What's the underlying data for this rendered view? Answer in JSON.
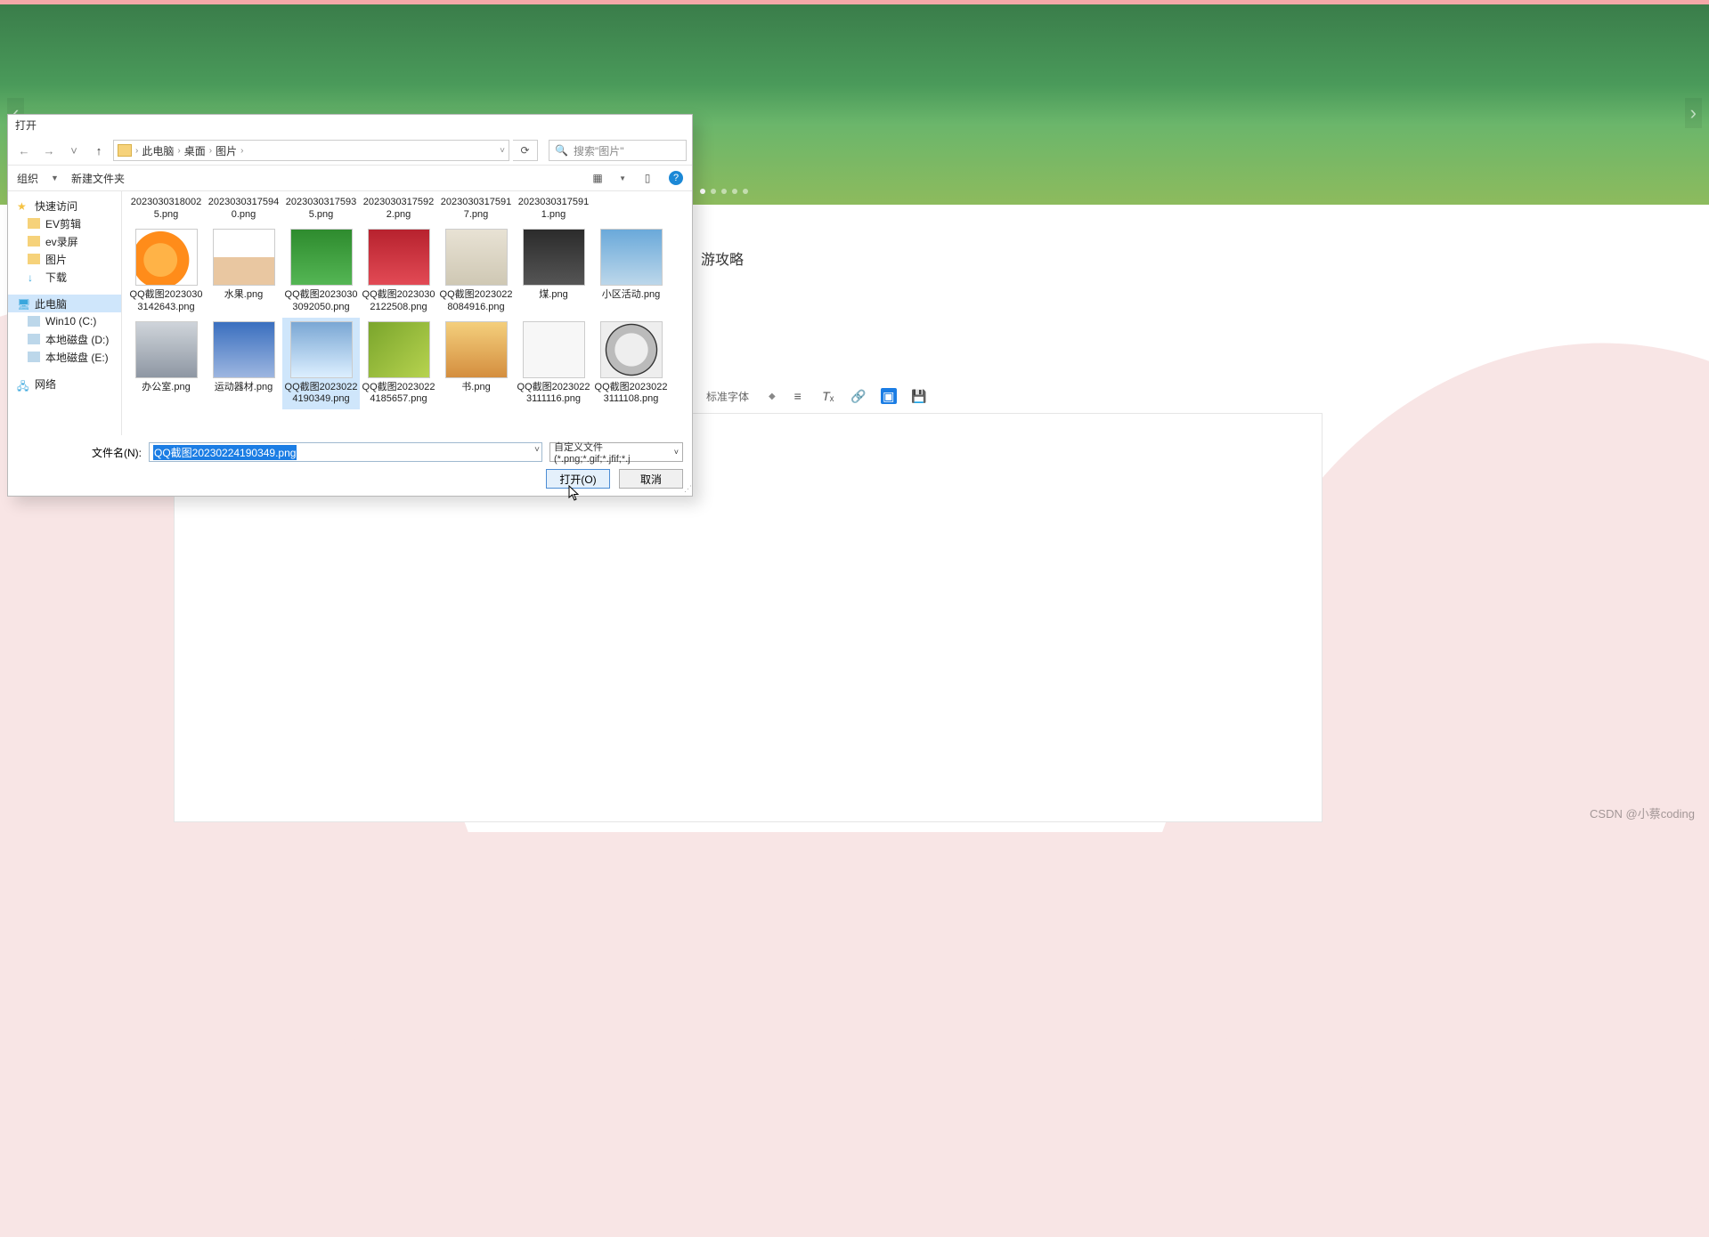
{
  "page": {
    "content_title": "游攻略",
    "watermark": "CSDN @小蔡coding"
  },
  "editor_toolbar": {
    "font_label": "标准字体"
  },
  "dialog": {
    "title": "打开",
    "breadcrumb": [
      "此电脑",
      "桌面",
      "图片"
    ],
    "search_placeholder": "搜索\"图片\"",
    "toolbar": {
      "organize": "组织",
      "new_folder": "新建文件夹"
    },
    "nav": {
      "quick_access": "快速访问",
      "items_quick": [
        "EV剪辑",
        "ev录屏",
        "图片",
        "下载"
      ],
      "this_pc": "此电脑",
      "drives": [
        "Win10 (C:)",
        "本地磁盘 (D:)",
        "本地磁盘 (E:)"
      ],
      "network": "网络"
    },
    "files_row0": [
      "20230303180025.png",
      "20230303175940.png",
      "20230303175935.png",
      "20230303175922.png",
      "20230303175917.png",
      "20230303175911.png"
    ],
    "files_row1": [
      {
        "label": "QQ截图20230303142643.png",
        "thumb": "orange"
      },
      {
        "label": "水果.png",
        "thumb": "fruit"
      },
      {
        "label": "QQ截图20230303092050.png",
        "thumb": "green"
      },
      {
        "label": "QQ截图20230302122508.png",
        "thumb": "red"
      },
      {
        "label": "QQ截图20230228084916.png",
        "thumb": "watch"
      },
      {
        "label": "煤.png",
        "thumb": "coal"
      },
      {
        "label": "小区活动.png",
        "thumb": "community"
      }
    ],
    "files_row2": [
      {
        "label": "办公室.png",
        "thumb": "office"
      },
      {
        "label": "运动器材.png",
        "thumb": "gym"
      },
      {
        "label": "QQ截图20230224190349.png",
        "thumb": "ferris",
        "selected": true
      },
      {
        "label": "QQ截图20230224185657.png",
        "thumb": "book"
      },
      {
        "label": "书.png",
        "thumb": "books"
      },
      {
        "label": "QQ截图20230223111116.png",
        "thumb": "tape"
      },
      {
        "label": "QQ截图20230223111108.png",
        "thumb": "disc"
      }
    ],
    "filename_label": "文件名(N):",
    "filename_value": "QQ截图20230224190349.png",
    "filetype": "自定义文件 (*.png;*.gif;*.jfif;*.j",
    "open_btn": "打开(O)",
    "cancel_btn": "取消"
  }
}
